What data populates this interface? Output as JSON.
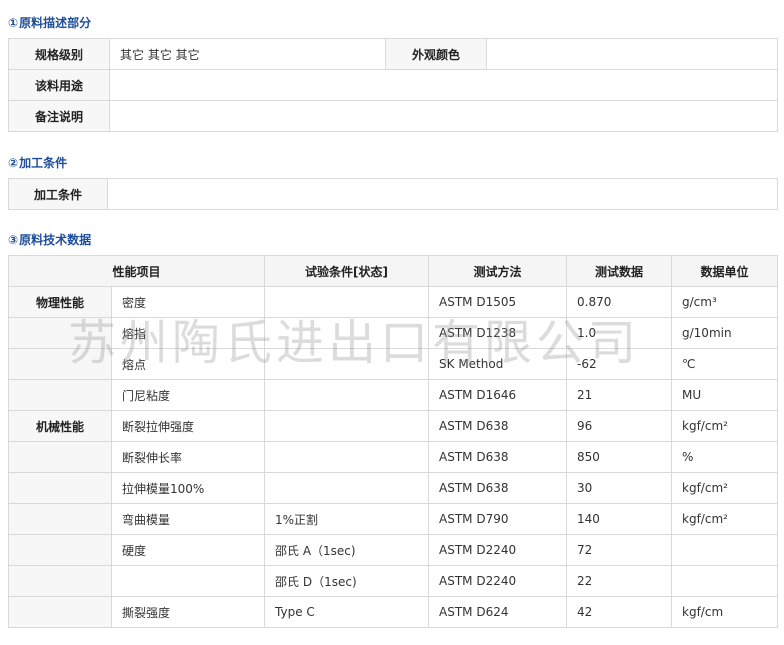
{
  "section1": {
    "number": "①",
    "title": "原料描述部分",
    "rows": {
      "grade_label": "规格级别",
      "grade_value": "其它 其它 其它",
      "color_label": "外观颜色",
      "color_value": "",
      "use_label": "该料用途",
      "use_value": "",
      "note_label": "备注说明",
      "note_value": ""
    }
  },
  "section2": {
    "number": "②",
    "title": "加工条件",
    "row_label": "加工条件",
    "row_value": ""
  },
  "section3": {
    "number": "③",
    "title": "原料技术数据",
    "headers": [
      "性能项目",
      "试验条件[状态]",
      "测试方法",
      "测试数据",
      "数据单位"
    ],
    "rows": [
      {
        "category": "物理性能",
        "property": "密度",
        "condition": "",
        "method": "ASTM D1505",
        "value": "0.870",
        "unit": "g/cm³"
      },
      {
        "category": "",
        "property": "熔指",
        "condition": "",
        "method": "ASTM D1238",
        "value": "1.0",
        "unit": "g/10min"
      },
      {
        "category": "",
        "property": "熔点",
        "condition": "",
        "method": "SK Method",
        "value": "-62",
        "unit": "℃"
      },
      {
        "category": "",
        "property": "门尼粘度",
        "condition": "",
        "method": "ASTM D1646",
        "value": "21",
        "unit": "MU"
      },
      {
        "category": "机械性能",
        "property": "断裂拉伸强度",
        "condition": "",
        "method": "ASTM D638",
        "value": "96",
        "unit": "kgf/cm²"
      },
      {
        "category": "",
        "property": "断裂伸长率",
        "condition": "",
        "method": "ASTM D638",
        "value": "850",
        "unit": "%"
      },
      {
        "category": "",
        "property": "拉伸模量100%",
        "condition": "",
        "method": "ASTM D638",
        "value": "30",
        "unit": "kgf/cm²"
      },
      {
        "category": "",
        "property": "弯曲模量",
        "condition": "1%正割",
        "method": "ASTM D790",
        "value": "140",
        "unit": "kgf/cm²"
      },
      {
        "category": "",
        "property": "硬度",
        "condition": "邵氏 A（1sec)",
        "method": "ASTM D2240",
        "value": "72",
        "unit": ""
      },
      {
        "category": "",
        "property": "",
        "condition": "邵氏 D（1sec)",
        "method": "ASTM D2240",
        "value": "22",
        "unit": ""
      },
      {
        "category": "",
        "property": "撕裂强度",
        "condition": "Type C",
        "method": "ASTM D624",
        "value": "42",
        "unit": "kgf/cm"
      }
    ]
  },
  "watermark": "苏州陶氏进出口有限公司"
}
